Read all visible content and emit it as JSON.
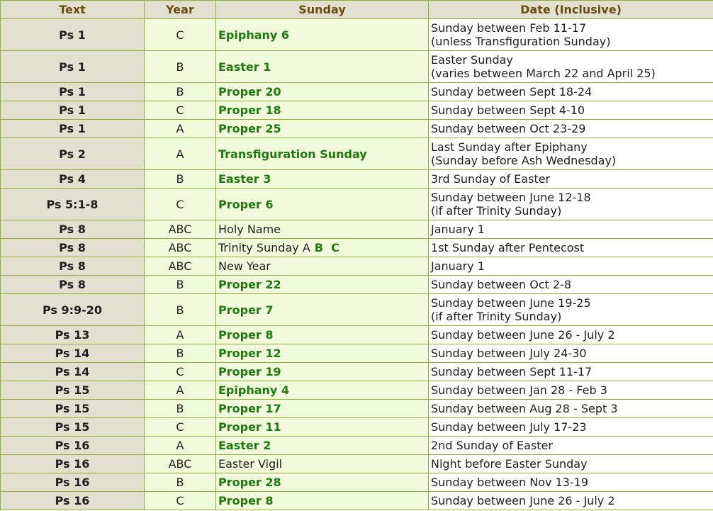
{
  "headers": {
    "text": "Text",
    "year": "Year",
    "sunday": "Sunday",
    "date": "Date (Inclusive)"
  },
  "rows": [
    {
      "text": "Ps 1",
      "text_color": "black",
      "year": "C",
      "sunday": "Epiphany 6",
      "sunday_bold": true,
      "date_line1": "Sunday between Feb 11-17",
      "date_line2": "(unless Transfiguration Sunday)"
    },
    {
      "text": "Ps 1",
      "text_color": "black",
      "year": "B",
      "sunday": "Easter 1",
      "sunday_bold": true,
      "date_line1": "Easter Sunday",
      "date_line2": "(varies between March 22 and April 25)"
    },
    {
      "text": "Ps 1",
      "text_color": "blue",
      "year": "B",
      "sunday": "Proper 20",
      "sunday_bold": true,
      "date_line1": "Sunday between Sept 18-24",
      "date_line2": ""
    },
    {
      "text": "Ps 1",
      "text_color": "green",
      "year": "C",
      "sunday": "Proper 18",
      "sunday_bold": true,
      "date_line1": "Sunday between Sept 4-10",
      "date_line2": ""
    },
    {
      "text": "Ps 1",
      "text_color": "green",
      "year": "A",
      "sunday": "Proper 25",
      "sunday_bold": true,
      "date_line1": "Sunday between Oct 23-29",
      "date_line2": ""
    },
    {
      "text": "Ps 2",
      "text_color": "red",
      "year": "A",
      "sunday": "Transfiguration Sunday",
      "sunday_bold": true,
      "date_line1": "Last Sunday after Epiphany",
      "date_line2": "(Sunday before Ash Wednesday)"
    },
    {
      "text": "Ps 4",
      "text_color": "black",
      "year": "B",
      "sunday": "Easter 3",
      "sunday_bold": true,
      "date_line1": "3rd Sunday of Easter",
      "date_line2": ""
    },
    {
      "text": "Ps 5:1-8",
      "text_color": "blue",
      "year": "C",
      "sunday": "Proper 6",
      "sunday_bold": true,
      "date_line1": "Sunday between June 12-18",
      "date_line2": "(if after Trinity Sunday)"
    },
    {
      "text": "Ps 8",
      "text_color": "black",
      "year": "ABC",
      "sunday": "Holy Name",
      "sunday_bold": false,
      "date_line1": "January 1",
      "date_line2": ""
    },
    {
      "text": "Ps 8",
      "text_color": "black",
      "year": "ABC",
      "sunday": "Trinity Sunday A",
      "sunday_bold": false,
      "sunday_years": "B  C",
      "date_line1": "1st Sunday after Pentecost",
      "date_line2": ""
    },
    {
      "text": "Ps 8",
      "text_color": "black",
      "year": "ABC",
      "sunday": "New Year",
      "sunday_bold": false,
      "date_line1": "January 1",
      "date_line2": ""
    },
    {
      "text": "Ps 8",
      "text_color": "green",
      "year": "B",
      "sunday": "Proper 22",
      "sunday_bold": true,
      "date_line1": "Sunday between Oct 2-8",
      "date_line2": ""
    },
    {
      "text": "Ps 9:9-20",
      "text_color": "red",
      "year": "B",
      "sunday": "Proper 7",
      "sunday_bold": true,
      "date_line1": "Sunday between June 19-25",
      "date_line2": "(if after Trinity Sunday)"
    },
    {
      "text": "Ps 13",
      "text_color": "blue",
      "year": "A",
      "sunday": "Proper 8",
      "sunday_bold": true,
      "date_line1": "Sunday between June 26 - July 2",
      "date_line2": ""
    },
    {
      "text": "Ps 14",
      "text_color": "blue",
      "year": "B",
      "sunday": "Proper 12",
      "sunday_bold": true,
      "date_line1": "Sunday between July 24-30",
      "date_line2": ""
    },
    {
      "text": "Ps 14",
      "text_color": "blue",
      "year": "C",
      "sunday": "Proper 19",
      "sunday_bold": true,
      "date_line1": "Sunday between Sept 11-17",
      "date_line2": ""
    },
    {
      "text": "Ps 15",
      "text_color": "black",
      "year": "A",
      "sunday": "Epiphany 4",
      "sunday_bold": true,
      "date_line1": "Sunday between Jan 28 - Feb 3",
      "date_line2": ""
    },
    {
      "text": "Ps 15",
      "text_color": "green",
      "year": "B",
      "sunday": "Proper 17",
      "sunday_bold": true,
      "date_line1": "Sunday between Aug 28 - Sept 3",
      "date_line2": ""
    },
    {
      "text": "Ps 15",
      "text_color": "green",
      "year": "C",
      "sunday": "Proper 11",
      "sunday_bold": true,
      "date_line1": "Sunday between July 17-23",
      "date_line2": ""
    },
    {
      "text": "Ps 16",
      "text_color": "black",
      "year": "A",
      "sunday": "Easter 2",
      "sunday_bold": true,
      "date_line1": "2nd Sunday of Easter",
      "date_line2": ""
    },
    {
      "text": "Ps 16",
      "text_color": "black",
      "year": "ABC",
      "sunday": "Easter Vigil",
      "sunday_bold": false,
      "date_line1": "Night before Easter Sunday",
      "date_line2": ""
    },
    {
      "text": "Ps 16",
      "text_color": "green",
      "year": "B",
      "sunday": "Proper 28",
      "sunday_bold": true,
      "date_line1": "Sunday between Nov 13-19",
      "date_line2": ""
    },
    {
      "text": "Ps 16",
      "text_color": "green",
      "year": "C",
      "sunday": "Proper 8",
      "sunday_bold": true,
      "date_line1": "Sunday between June 26 - July 2",
      "date_line2": ""
    }
  ]
}
